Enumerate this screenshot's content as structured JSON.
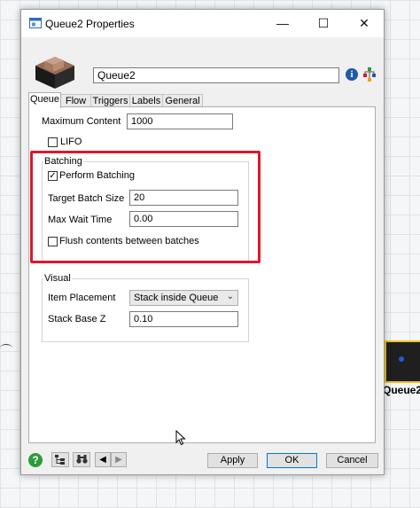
{
  "window": {
    "title": "Queue2  Properties",
    "controls": {
      "minimize": "—",
      "maximize": "☐",
      "close": "✕"
    },
    "object_name": "Queue2",
    "icons": {
      "app": "app-window-icon",
      "object": "queue-box-icon",
      "info": "info-icon",
      "properties": "properties-tree-icon"
    },
    "info_glyph": "i"
  },
  "tabs": [
    "Queue",
    "Flow",
    "Triggers",
    "Labels",
    "General"
  ],
  "active_tab": "Queue",
  "queue": {
    "max_content_label": "Maximum Content",
    "max_content_value": "1000",
    "lifo_label": "LIFO",
    "lifo_checked": false
  },
  "batching": {
    "title": "Batching",
    "perform_label": "Perform Batching",
    "perform_checked": true,
    "target_label": "Target Batch Size",
    "target_value": "20",
    "maxwait_label": "Max Wait Time",
    "maxwait_value": "0.00",
    "flush_label": "Flush contents between batches",
    "flush_checked": false
  },
  "visual": {
    "title": "Visual",
    "placement_label": "Item Placement",
    "placement_value": "Stack inside Queue",
    "stackz_label": "Stack Base Z",
    "stackz_value": "0.10"
  },
  "bottom": {
    "help_glyph": "?",
    "nav_prev": "◀",
    "nav_next": "▶",
    "apply": "Apply",
    "ok": "OK",
    "cancel": "Cancel"
  },
  "background": {
    "object_label": "Queue2"
  },
  "colors": {
    "highlight": "#e0162b",
    "accent": "#0078d7",
    "help": "#2e9a3c"
  }
}
